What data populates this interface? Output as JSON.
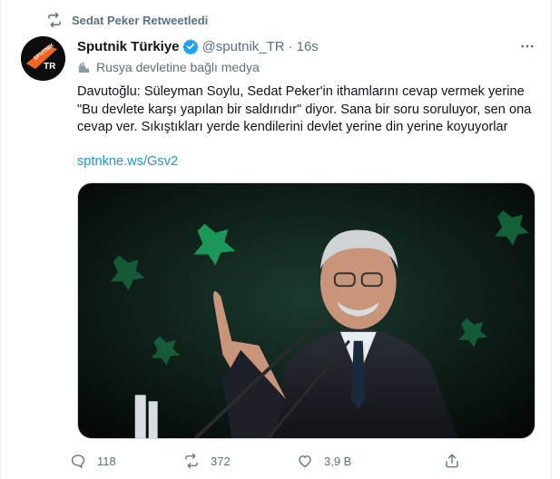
{
  "retweet": {
    "label": "Sedat Peker Retweetledi"
  },
  "author": {
    "name": "Sputnik Türkiye",
    "handle": "@sputnik_TR",
    "separator": "·",
    "time": "16s",
    "avatar_text": "TR",
    "avatar_logo_text": "SPUTNIK"
  },
  "state_label": "Rusya devletine bağlı medya",
  "tweet": {
    "text": "Davutoğlu: Süleyman Soylu, Sedat Peker'in ithamlarını cevap vermek yerine \"Bu devlete karşı yapılan bir saldırıdır\" diyor. Sana bir soru soruluyor, sen ona cevap ver. Sıkıştıkları yerde kendilerini devlet yerine din yerine koyuyorlar",
    "link": "sptnkne.ws/Gsv2"
  },
  "actions": {
    "reply_count": "118",
    "retweet_count": "372",
    "like_count": "3,9 B"
  },
  "colors": {
    "accent": "#1b95e0",
    "muted": "#5b7083",
    "verified": "#1da1f2",
    "avatar_orange": "#f26522"
  }
}
